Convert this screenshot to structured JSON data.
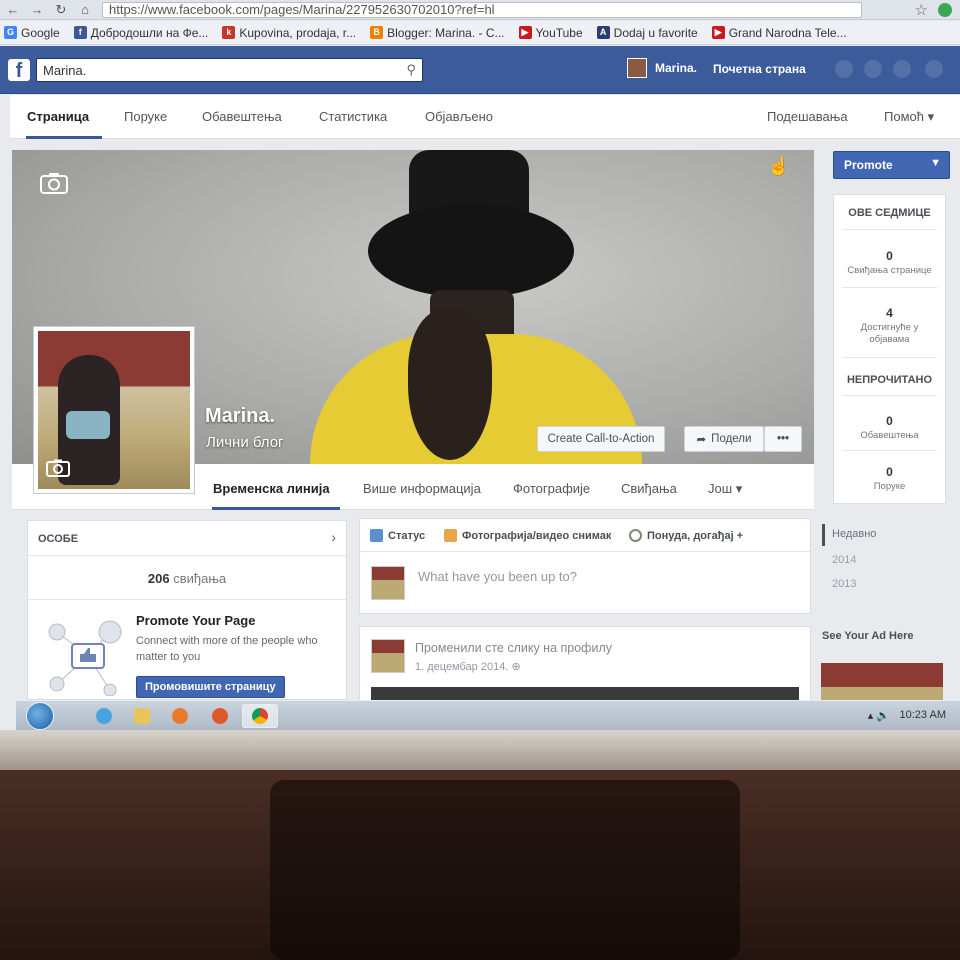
{
  "browser": {
    "url": "https://www.facebook.com/pages/Marina/227952630702010?ref=hl",
    "bookmarks": [
      {
        "label": "Google",
        "color": "#4285f4",
        "glyph": "G"
      },
      {
        "label": "Добродошли на Фе...",
        "color": "#3b5998",
        "glyph": "f"
      },
      {
        "label": "Kupovina, prodaja, r...",
        "color": "#c0392b",
        "glyph": "k"
      },
      {
        "label": "Blogger: Marina. - C...",
        "color": "#f57d00",
        "glyph": "B"
      },
      {
        "label": "YouTube",
        "color": "#cc181e",
        "glyph": "▶"
      },
      {
        "label": "Dodaj u favorite",
        "color": "#2c3e70",
        "glyph": "A"
      },
      {
        "label": "Grand Narodna Tele...",
        "color": "#cc181e",
        "glyph": "▶"
      }
    ]
  },
  "fbbar": {
    "search_value": "Marina.",
    "user_name": "Marina.",
    "home_label": "Почетна страна"
  },
  "page_nav": {
    "items": [
      "Страница",
      "Поруке",
      "Обавештења",
      "Статистика",
      "Објављено"
    ],
    "right": [
      "Подешавања",
      "Помоћ ▾"
    ]
  },
  "cover": {
    "page_name": "Marina.",
    "page_category": "Лични блог",
    "cta_label": "Create Call-to-Action",
    "share_label": "Подели",
    "more_label": "•••"
  },
  "timeline_tabs": [
    "Временска линија",
    "Више информација",
    "Фотографије",
    "Свиђања",
    "Још ▾"
  ],
  "right_col": {
    "promote_label": "Promote",
    "this_week_head": "ОВЕ СЕДМИЦЕ",
    "stats": [
      {
        "num": "0",
        "label": "Свиђања странице"
      },
      {
        "num": "4",
        "label": "Достигнуће у објавама"
      }
    ],
    "unread_head": "НЕПРОЧИТАНО",
    "unread": [
      {
        "num": "0",
        "label": "Обавештења"
      },
      {
        "num": "0",
        "label": "Поруке"
      }
    ],
    "years": [
      "Недавно",
      "2014",
      "2013"
    ],
    "see_ad": "See Your Ad Here"
  },
  "people": {
    "head": "ОСОБЕ",
    "likes_num": "206",
    "likes_label": "свиђања",
    "promo_title": "Promote Your Page",
    "promo_desc": "Connect with more of the people who matter to you",
    "promo_btn": "Промовишите страницу"
  },
  "composer": {
    "tabs": [
      "Статус",
      "Фотографија/видео снимак",
      "Понуда, догађај +"
    ],
    "placeholder": "What have you been up to?"
  },
  "post": {
    "title": "Променили сте слику на профилу",
    "date": "1. децембар 2014."
  },
  "taskbar": {
    "clock": "10:23 AM"
  }
}
